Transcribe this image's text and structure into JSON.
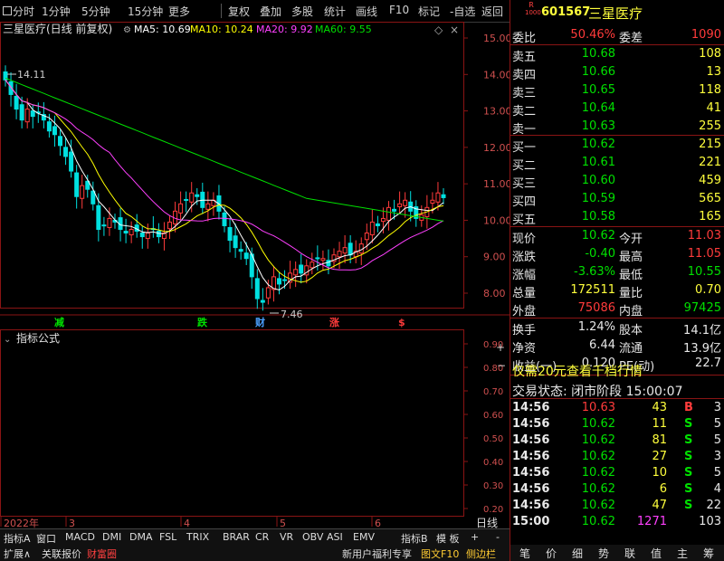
{
  "toolbar": {
    "items": [
      "分时",
      "1分钟",
      "5分钟",
      "15分钟",
      "更多",
      "复权",
      "叠加",
      "多股",
      "统计",
      "画线",
      "F10",
      "标记",
      "-自选",
      "返回"
    ]
  },
  "stock": {
    "code": "601567",
    "name": "三星医疗",
    "badge": "R",
    "badge_sub": "1000"
  },
  "chart": {
    "title": "三星医疗(日线 前复权)",
    "ma_labels": [
      {
        "text": "MA5: 10.69",
        "color": "#ffffff"
      },
      {
        "text": "MA10: 10.24",
        "color": "#ffff00"
      },
      {
        "text": "MA20: 9.92",
        "color": "#ff40ff"
      },
      {
        "text": "MA60: 9.55",
        "color": "#00e000"
      }
    ],
    "y_ticks": [
      "15.00",
      "14.00",
      "13.00",
      "12.00",
      "11.00",
      "10.00",
      "9.00",
      "8.00"
    ],
    "y_values": [
      15,
      14,
      13,
      12,
      11,
      10,
      9,
      8
    ],
    "high_label": "14.11",
    "low_label": "7.46",
    "markers": [
      {
        "text": "减",
        "color": "#00e000"
      },
      {
        "text": "跌",
        "color": "#00e000"
      },
      {
        "text": "财",
        "color": "#4aa0ff"
      },
      {
        "text": "涨",
        "color": "#ff3b3b"
      },
      {
        "text": "$",
        "color": "#ff3b3b"
      }
    ],
    "indicator_title": "指标公式",
    "indicator_ticks": [
      "0.90",
      "0.80",
      "0.70",
      "0.60",
      "0.50",
      "0.40",
      "0.30",
      "0.20",
      "0.10"
    ],
    "x_labels": [
      "2022年",
      "3",
      "4",
      "5",
      "6"
    ],
    "period_label": "日线",
    "closes": [
      13.85,
      13.45,
      13.05,
      12.75,
      13.05,
      12.85,
      12.95,
      12.75,
      12.45,
      12.35,
      12.05,
      11.75,
      11.35,
      10.65,
      10.95,
      10.85,
      10.45,
      9.75,
      9.85,
      10.05,
      9.95,
      9.75,
      9.65,
      9.75,
      9.7,
      9.55,
      9.65,
      9.75,
      9.55,
      9.65,
      9.95,
      10.25,
      10.45,
      10.55,
      10.75,
      10.65,
      10.35,
      10.45,
      10.55,
      10.25,
      9.85,
      9.45,
      9.25,
      9.15,
      8.95,
      8.45,
      7.85,
      7.75,
      8.15,
      8.45,
      8.25,
      8.35,
      8.55,
      8.65,
      8.55,
      8.75,
      8.85,
      8.95,
      8.95,
      8.75,
      9.05,
      9.15,
      9.25,
      9.05,
      9.15,
      9.35,
      9.65,
      9.95,
      9.85,
      10.05,
      10.35,
      10.25,
      10.45,
      10.55,
      10.25,
      10.05,
      10.15,
      10.35,
      10.55,
      10.75,
      10.62
    ]
  },
  "quote": {
    "weibi_label": "委比",
    "weibi": "50.46%",
    "weicha_label": "委差",
    "weicha": "1090",
    "sells": [
      {
        "label": "卖五",
        "price": "10.68",
        "vol": "108"
      },
      {
        "label": "卖四",
        "price": "10.66",
        "vol": "13"
      },
      {
        "label": "卖三",
        "price": "10.65",
        "vol": "118"
      },
      {
        "label": "卖二",
        "price": "10.64",
        "vol": "41"
      },
      {
        "label": "卖一",
        "price": "10.63",
        "vol": "255"
      }
    ],
    "buys": [
      {
        "label": "买一",
        "price": "10.62",
        "vol": "215"
      },
      {
        "label": "买二",
        "price": "10.61",
        "vol": "221"
      },
      {
        "label": "买三",
        "price": "10.60",
        "vol": "459"
      },
      {
        "label": "买四",
        "price": "10.59",
        "vol": "565"
      },
      {
        "label": "买五",
        "price": "10.58",
        "vol": "165"
      }
    ],
    "stats": [
      {
        "l1": "现价",
        "v1": "10.62",
        "c1": "grn",
        "l2": "今开",
        "v2": "11.03",
        "c2": "red"
      },
      {
        "l1": "涨跌",
        "v1": "-0.40",
        "c1": "grn",
        "l2": "最高",
        "v2": "11.05",
        "c2": "red"
      },
      {
        "l1": "涨幅",
        "v1": "-3.63%",
        "c1": "grn",
        "l2": "最低",
        "v2": "10.55",
        "c2": "grn"
      },
      {
        "l1": "总量",
        "v1": "172511",
        "c1": "yel",
        "l2": "量比",
        "v2": "0.70",
        "c2": "yel"
      },
      {
        "l1": "外盘",
        "v1": "75086",
        "c1": "red",
        "l2": "内盘",
        "v2": "97425",
        "c2": "grn"
      }
    ],
    "stats2": [
      {
        "l1": "换手",
        "v1": "1.24%",
        "l2": "股本",
        "v2": "14.1亿"
      },
      {
        "l1": "净资",
        "v1": "6.44",
        "l2": "流通",
        "v2": "13.9亿"
      },
      {
        "l1": "收益(一)",
        "v1": "0.120",
        "l2": "PE(动)",
        "v2": "22.7"
      }
    ],
    "promo": "仅需20元查看千档行情",
    "trade_status": "交易状态: 闭市阶段 15:00:07",
    "ticks": [
      {
        "t": "14:56",
        "p": "10.63",
        "v": "43",
        "d": "B",
        "n": "3",
        "pc": "red",
        "vc": "yel",
        "dc": "red"
      },
      {
        "t": "14:56",
        "p": "10.62",
        "v": "11",
        "d": "S",
        "n": "5",
        "pc": "grn",
        "vc": "yel",
        "dc": "grn"
      },
      {
        "t": "14:56",
        "p": "10.62",
        "v": "81",
        "d": "S",
        "n": "5",
        "pc": "grn",
        "vc": "yel",
        "dc": "grn"
      },
      {
        "t": "14:56",
        "p": "10.62",
        "v": "27",
        "d": "S",
        "n": "3",
        "pc": "grn",
        "vc": "yel",
        "dc": "grn"
      },
      {
        "t": "14:56",
        "p": "10.62",
        "v": "10",
        "d": "S",
        "n": "5",
        "pc": "grn",
        "vc": "yel",
        "dc": "grn"
      },
      {
        "t": "14:56",
        "p": "10.62",
        "v": "6",
        "d": "S",
        "n": "4",
        "pc": "grn",
        "vc": "yel",
        "dc": "grn"
      },
      {
        "t": "14:56",
        "p": "10.62",
        "v": "47",
        "d": "S",
        "n": "22",
        "pc": "grn",
        "vc": "yel",
        "dc": "grn"
      },
      {
        "t": "15:00",
        "p": "10.62",
        "v": "1271",
        "d": "",
        "n": "103",
        "pc": "grn",
        "vc": "mag",
        "dc": "grn"
      }
    ]
  },
  "tabs": [
    "指标A",
    "窗口",
    "MACD",
    "DMI",
    "DMA",
    "FSL",
    "TRIX",
    "BRAR",
    "CR",
    "VR",
    "OBV",
    "ASI",
    "EMV",
    "指标B",
    "模 板",
    "+",
    "-"
  ],
  "bottom_left": [
    "扩展∧",
    "关联报价",
    "财富圈"
  ],
  "bottom_mid": [
    "新用户福利专享",
    "图文F10",
    "侧边栏"
  ],
  "right_tabs": [
    "笔",
    "价",
    "细",
    "势",
    "联",
    "值",
    "主",
    "筹"
  ]
}
